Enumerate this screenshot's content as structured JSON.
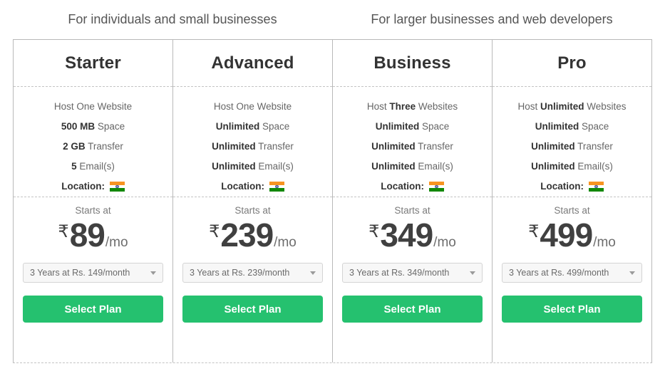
{
  "taglines": {
    "left": "For individuals and small businesses",
    "right": "For larger businesses and web developers"
  },
  "accent_color": "#25c16f",
  "currency_symbol": "₹",
  "per_period": "/mo",
  "starts_at_label": "Starts at",
  "select_plan_label": "Select Plan",
  "flag_icon": "india-flag-icon",
  "location_label": "Location:",
  "plans": [
    {
      "name": "Starter",
      "features": [
        {
          "pre": "Host ",
          "bold": "One",
          "post": " Website",
          "bold_first": false,
          "plain": "Host One Website"
        },
        {
          "bold": "500 MB",
          "post": " Space"
        },
        {
          "bold": "2 GB",
          "post": " Transfer"
        },
        {
          "bold": "5",
          "post": " Email(s)"
        }
      ],
      "location": "Location:",
      "starts_at": "Starts at",
      "currency": "₹",
      "price": "89",
      "period": "/mo",
      "term": "3 Years at Rs. 149/month",
      "button": "Select Plan"
    },
    {
      "name": "Advanced",
      "features": [
        {
          "plain": "Host One Website"
        },
        {
          "bold": "Unlimited",
          "post": " Space"
        },
        {
          "bold": "Unlimited",
          "post": " Transfer"
        },
        {
          "bold": "Unlimited",
          "post": " Email(s)"
        }
      ],
      "location": "Location:",
      "starts_at": "Starts at",
      "currency": "₹",
      "price": "239",
      "period": "/mo",
      "term": "3 Years at Rs. 239/month",
      "button": "Select Plan"
    },
    {
      "name": "Business",
      "features": [
        {
          "pre": "Host ",
          "bold": "Three",
          "post": " Websites"
        },
        {
          "bold": "Unlimited",
          "post": " Space"
        },
        {
          "bold": "Unlimited",
          "post": " Transfer"
        },
        {
          "bold": "Unlimited",
          "post": " Email(s)"
        }
      ],
      "location": "Location:",
      "starts_at": "Starts at",
      "currency": "₹",
      "price": "349",
      "period": "/mo",
      "term": "3 Years at Rs. 349/month",
      "button": "Select Plan"
    },
    {
      "name": "Pro",
      "features": [
        {
          "pre": "Host ",
          "bold": "Unlimited",
          "post": " Websites"
        },
        {
          "bold": "Unlimited",
          "post": " Space"
        },
        {
          "bold": "Unlimited",
          "post": " Transfer"
        },
        {
          "bold": "Unlimited",
          "post": " Email(s)"
        }
      ],
      "location": "Location:",
      "starts_at": "Starts at",
      "currency": "₹",
      "price": "499",
      "period": "/mo",
      "term": "3 Years at Rs. 499/month",
      "button": "Select Plan"
    }
  ]
}
